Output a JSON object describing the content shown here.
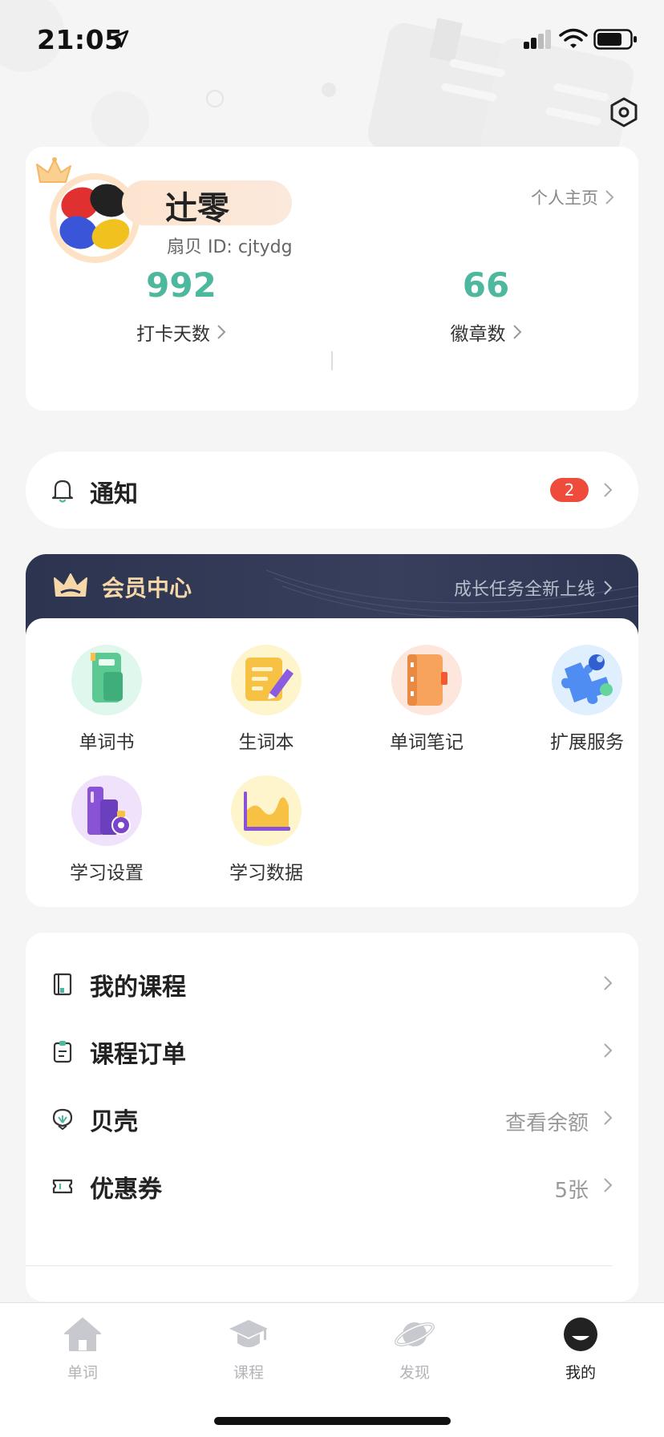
{
  "status_bar": {
    "time": "21:05"
  },
  "profile": {
    "name": "辻零",
    "user_id": "扇贝 ID: cjtydg",
    "homepage_link": "个人主页",
    "stats": [
      {
        "value": "992",
        "label": "打卡天数"
      },
      {
        "value": "66",
        "label": "徽章数"
      }
    ]
  },
  "notification": {
    "title": "通知",
    "badge_count": "2"
  },
  "vip": {
    "title": "会员中心",
    "link": "成长任务全新上线",
    "items": [
      {
        "label": "单词书",
        "icon": "word-book-icon"
      },
      {
        "label": "生词本",
        "icon": "vocab-notebook-icon"
      },
      {
        "label": "单词笔记",
        "icon": "word-notes-icon"
      },
      {
        "label": "扩展服务",
        "icon": "puzzle-icon"
      },
      {
        "label": "学习设置",
        "icon": "study-settings-icon"
      },
      {
        "label": "学习数据",
        "icon": "area-chart-icon"
      }
    ]
  },
  "menu": {
    "items": [
      {
        "title": "我的课程",
        "extra": "",
        "icon": "book-icon"
      },
      {
        "title": "课程订单",
        "extra": "",
        "icon": "clipboard-icon"
      },
      {
        "title": "贝壳",
        "extra": "查看余额",
        "icon": "shell-icon"
      },
      {
        "title": "优惠券",
        "extra": "5张",
        "icon": "coupon-icon"
      }
    ]
  },
  "tab_bar": {
    "tabs": [
      {
        "label": "单词",
        "icon": "house-icon",
        "active": false
      },
      {
        "label": "课程",
        "icon": "grad-cap-icon",
        "active": false
      },
      {
        "label": "发现",
        "icon": "planet-icon",
        "active": false
      },
      {
        "label": "我的",
        "icon": "user-face-icon",
        "active": true
      }
    ]
  },
  "colors": {
    "accent_green": "#4db89e",
    "badge_red": "#ef4b3c",
    "vip_dark": "#2c3450",
    "vip_gold": "#f6d7a8"
  }
}
